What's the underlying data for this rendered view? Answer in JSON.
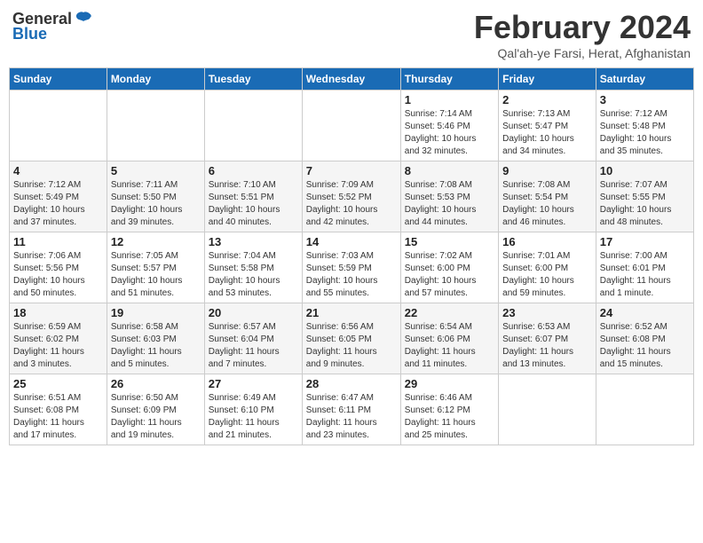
{
  "header": {
    "logo_general": "General",
    "logo_blue": "Blue",
    "month_year": "February 2024",
    "location": "Qal'ah-ye Farsi, Herat, Afghanistan"
  },
  "columns": [
    "Sunday",
    "Monday",
    "Tuesday",
    "Wednesday",
    "Thursday",
    "Friday",
    "Saturday"
  ],
  "weeks": [
    {
      "days": [
        {
          "num": "",
          "info": ""
        },
        {
          "num": "",
          "info": ""
        },
        {
          "num": "",
          "info": ""
        },
        {
          "num": "",
          "info": ""
        },
        {
          "num": "1",
          "info": "Sunrise: 7:14 AM\nSunset: 5:46 PM\nDaylight: 10 hours\nand 32 minutes."
        },
        {
          "num": "2",
          "info": "Sunrise: 7:13 AM\nSunset: 5:47 PM\nDaylight: 10 hours\nand 34 minutes."
        },
        {
          "num": "3",
          "info": "Sunrise: 7:12 AM\nSunset: 5:48 PM\nDaylight: 10 hours\nand 35 minutes."
        }
      ]
    },
    {
      "days": [
        {
          "num": "4",
          "info": "Sunrise: 7:12 AM\nSunset: 5:49 PM\nDaylight: 10 hours\nand 37 minutes."
        },
        {
          "num": "5",
          "info": "Sunrise: 7:11 AM\nSunset: 5:50 PM\nDaylight: 10 hours\nand 39 minutes."
        },
        {
          "num": "6",
          "info": "Sunrise: 7:10 AM\nSunset: 5:51 PM\nDaylight: 10 hours\nand 40 minutes."
        },
        {
          "num": "7",
          "info": "Sunrise: 7:09 AM\nSunset: 5:52 PM\nDaylight: 10 hours\nand 42 minutes."
        },
        {
          "num": "8",
          "info": "Sunrise: 7:08 AM\nSunset: 5:53 PM\nDaylight: 10 hours\nand 44 minutes."
        },
        {
          "num": "9",
          "info": "Sunrise: 7:08 AM\nSunset: 5:54 PM\nDaylight: 10 hours\nand 46 minutes."
        },
        {
          "num": "10",
          "info": "Sunrise: 7:07 AM\nSunset: 5:55 PM\nDaylight: 10 hours\nand 48 minutes."
        }
      ]
    },
    {
      "days": [
        {
          "num": "11",
          "info": "Sunrise: 7:06 AM\nSunset: 5:56 PM\nDaylight: 10 hours\nand 50 minutes."
        },
        {
          "num": "12",
          "info": "Sunrise: 7:05 AM\nSunset: 5:57 PM\nDaylight: 10 hours\nand 51 minutes."
        },
        {
          "num": "13",
          "info": "Sunrise: 7:04 AM\nSunset: 5:58 PM\nDaylight: 10 hours\nand 53 minutes."
        },
        {
          "num": "14",
          "info": "Sunrise: 7:03 AM\nSunset: 5:59 PM\nDaylight: 10 hours\nand 55 minutes."
        },
        {
          "num": "15",
          "info": "Sunrise: 7:02 AM\nSunset: 6:00 PM\nDaylight: 10 hours\nand 57 minutes."
        },
        {
          "num": "16",
          "info": "Sunrise: 7:01 AM\nSunset: 6:00 PM\nDaylight: 10 hours\nand 59 minutes."
        },
        {
          "num": "17",
          "info": "Sunrise: 7:00 AM\nSunset: 6:01 PM\nDaylight: 11 hours\nand 1 minute."
        }
      ]
    },
    {
      "days": [
        {
          "num": "18",
          "info": "Sunrise: 6:59 AM\nSunset: 6:02 PM\nDaylight: 11 hours\nand 3 minutes."
        },
        {
          "num": "19",
          "info": "Sunrise: 6:58 AM\nSunset: 6:03 PM\nDaylight: 11 hours\nand 5 minutes."
        },
        {
          "num": "20",
          "info": "Sunrise: 6:57 AM\nSunset: 6:04 PM\nDaylight: 11 hours\nand 7 minutes."
        },
        {
          "num": "21",
          "info": "Sunrise: 6:56 AM\nSunset: 6:05 PM\nDaylight: 11 hours\nand 9 minutes."
        },
        {
          "num": "22",
          "info": "Sunrise: 6:54 AM\nSunset: 6:06 PM\nDaylight: 11 hours\nand 11 minutes."
        },
        {
          "num": "23",
          "info": "Sunrise: 6:53 AM\nSunset: 6:07 PM\nDaylight: 11 hours\nand 13 minutes."
        },
        {
          "num": "24",
          "info": "Sunrise: 6:52 AM\nSunset: 6:08 PM\nDaylight: 11 hours\nand 15 minutes."
        }
      ]
    },
    {
      "days": [
        {
          "num": "25",
          "info": "Sunrise: 6:51 AM\nSunset: 6:08 PM\nDaylight: 11 hours\nand 17 minutes."
        },
        {
          "num": "26",
          "info": "Sunrise: 6:50 AM\nSunset: 6:09 PM\nDaylight: 11 hours\nand 19 minutes."
        },
        {
          "num": "27",
          "info": "Sunrise: 6:49 AM\nSunset: 6:10 PM\nDaylight: 11 hours\nand 21 minutes."
        },
        {
          "num": "28",
          "info": "Sunrise: 6:47 AM\nSunset: 6:11 PM\nDaylight: 11 hours\nand 23 minutes."
        },
        {
          "num": "29",
          "info": "Sunrise: 6:46 AM\nSunset: 6:12 PM\nDaylight: 11 hours\nand 25 minutes."
        },
        {
          "num": "",
          "info": ""
        },
        {
          "num": "",
          "info": ""
        }
      ]
    }
  ]
}
